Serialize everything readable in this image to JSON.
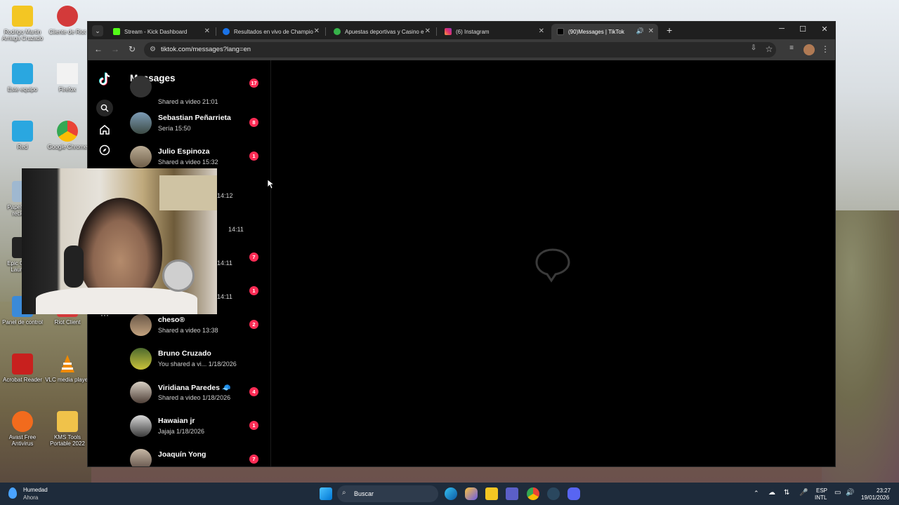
{
  "desktop": {
    "icons": [
      {
        "label": "Rodrigo Martin Arriaga Cruzado",
        "color": "#f3c623"
      },
      {
        "label": "Cliente de Riot",
        "color": "#d33a3a"
      },
      {
        "label": "Este equipo",
        "color": "#2aa7e0"
      },
      {
        "label": "Firefox",
        "color": "#f2f2f2"
      },
      {
        "label": "Red",
        "color": "#2aa7e0"
      },
      {
        "label": "Google Chrome",
        "color": "#4285f4"
      },
      {
        "label": "Papelera de reciclaje",
        "color": "#9fb8d0"
      },
      {
        "label": "Epic Games Launcher",
        "color": "#222222"
      },
      {
        "label": "Panel de control",
        "color": "#3b8ad8"
      },
      {
        "label": "Riot Client",
        "color": "#d33a3a"
      },
      {
        "label": "Acrobat Reader",
        "color": "#c8201e"
      },
      {
        "label": "VLC media player",
        "color": "#f08a00"
      },
      {
        "label": "Avast Free Antivirus",
        "color": "#f26b1d"
      },
      {
        "label": "KMS Tools Portable 2022",
        "color": "#f0c24a"
      }
    ]
  },
  "browser": {
    "tabs": [
      {
        "title": "Stream - Kick Dashboard",
        "fav_color": "#53fc18",
        "active": false
      },
      {
        "title": "Resultados en vivo de Champio",
        "fav_color": "#1a73e8",
        "active": false
      },
      {
        "title": "Apuestas deportivas y Casino e",
        "fav_color": "#36b34a",
        "active": false
      },
      {
        "title": "(6) Instagram",
        "fav_color": "#e1306c",
        "active": false
      },
      {
        "title": "(90)Messages | TikTok",
        "fav_color": "#ffffff",
        "active": true
      }
    ],
    "new_tab": "+",
    "url": "tiktok.com/messages?lang=en",
    "controls": {
      "minimize": "─",
      "maximize": "☐",
      "close": "✕"
    }
  },
  "tiktok": {
    "panel_title": "Messages",
    "conversations": [
      {
        "name": "",
        "preview": "Shared a video 21:01",
        "badge": "17"
      },
      {
        "name": "Sebastian Peñarrieta",
        "preview": "Sería 15:50",
        "badge": "8"
      },
      {
        "name": "Julio Espinoza",
        "preview": "Shared a video 15:32",
        "badge": "1"
      },
      {
        "name": "",
        "preview": "14:12",
        "badge": ""
      },
      {
        "name": "",
        "preview": "14:11",
        "badge": ""
      },
      {
        "name": "",
        "preview": "14:11",
        "badge": "7"
      },
      {
        "name": "",
        "preview": "14:11",
        "badge": "1"
      },
      {
        "name": "cheso®",
        "preview": "Shared a video 13:38",
        "badge": "2"
      },
      {
        "name": "Bruno Cruzado",
        "preview": "You shared a vi... 1/18/2026",
        "badge": ""
      },
      {
        "name": "Viridiana Paredes 🧢",
        "preview": "Shared a video 1/18/2026",
        "badge": "4"
      },
      {
        "name": "Hawaian jr",
        "preview": "Jajaja 1/18/2026",
        "badge": "1"
      },
      {
        "name": "Joaquín Yong",
        "preview": "",
        "badge": "7"
      }
    ]
  },
  "taskbar": {
    "weather_title": "Humedad",
    "weather_sub": "Ahora",
    "search_placeholder": "Buscar",
    "lang_top": "ESP",
    "lang_bottom": "INTL",
    "time": "23:27",
    "date": "19/01/2026"
  }
}
